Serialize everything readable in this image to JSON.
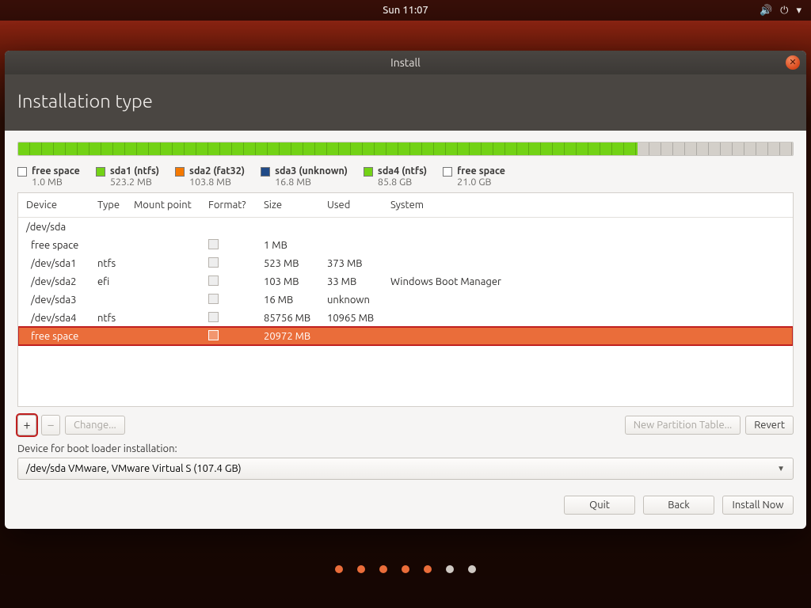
{
  "topbar": {
    "clock": "Sun 11:07"
  },
  "window": {
    "title": "Install",
    "heading": "Installation type"
  },
  "legend": [
    {
      "swatch": "none",
      "label": "free space",
      "sub": "1.0 MB"
    },
    {
      "swatch": "green",
      "label": "sda1 (ntfs)",
      "sub": "523.2 MB"
    },
    {
      "swatch": "orange",
      "label": "sda2 (fat32)",
      "sub": "103.8 MB"
    },
    {
      "swatch": "blue",
      "label": "sda3 (unknown)",
      "sub": "16.8 MB"
    },
    {
      "swatch": "green",
      "label": "sda4 (ntfs)",
      "sub": "85.8 GB"
    },
    {
      "swatch": "none",
      "label": "free space",
      "sub": "21.0 GB"
    }
  ],
  "columns": {
    "device": "Device",
    "type": "Type",
    "mount": "Mount point",
    "format": "Format?",
    "size": "Size",
    "used": "Used",
    "system": "System"
  },
  "group": "/dev/sda",
  "rows": [
    {
      "device": "free space",
      "type": "",
      "size": "1 MB",
      "used": "",
      "system": "",
      "selected": false
    },
    {
      "device": "/dev/sda1",
      "type": "ntfs",
      "size": "523 MB",
      "used": "373 MB",
      "system": "",
      "selected": false
    },
    {
      "device": "/dev/sda2",
      "type": "efi",
      "size": "103 MB",
      "used": "33 MB",
      "system": "Windows Boot Manager",
      "selected": false
    },
    {
      "device": "/dev/sda3",
      "type": "",
      "size": "16 MB",
      "used": "unknown",
      "system": "",
      "selected": false
    },
    {
      "device": "/dev/sda4",
      "type": "ntfs",
      "size": "85756 MB",
      "used": "10965 MB",
      "system": "",
      "selected": false
    },
    {
      "device": "free space",
      "type": "",
      "size": "20972 MB",
      "used": "",
      "system": "",
      "selected": true
    }
  ],
  "buttons": {
    "add": "+",
    "remove": "−",
    "change": "Change...",
    "newtable": "New Partition Table...",
    "revert": "Revert",
    "quit": "Quit",
    "back": "Back",
    "install": "Install Now"
  },
  "boot": {
    "label": "Device for boot loader installation:",
    "value": "/dev/sda   VMware, VMware Virtual S (107.4 GB)"
  }
}
